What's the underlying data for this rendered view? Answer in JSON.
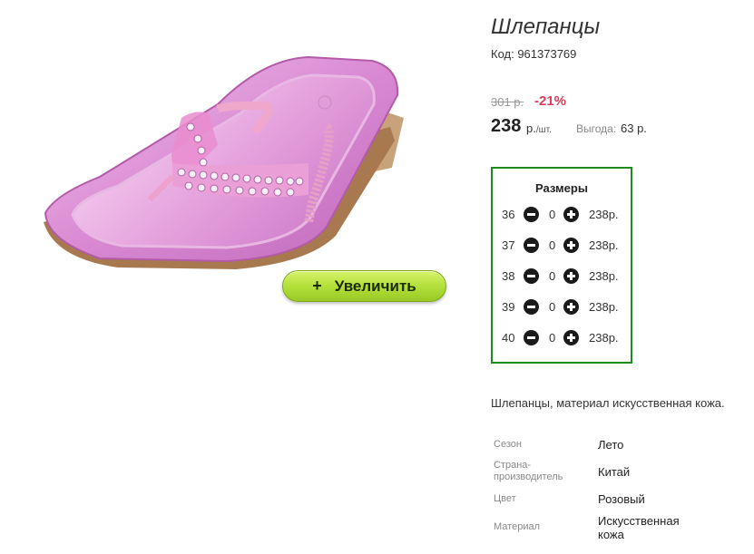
{
  "product": {
    "title": "Шлепанцы",
    "sku": "Код: 961373769",
    "old_price": "301 р.",
    "discount": "-21%",
    "price": "238",
    "price_unit": "р.",
    "price_unit_suffix": "/шт.",
    "benefit_label": "Выгода:",
    "benefit_value": "63 р."
  },
  "gallery": {
    "zoom_label": "Увеличить",
    "zoom_icon": "plus"
  },
  "sizes": {
    "title": "Размеры",
    "rows": [
      {
        "size": "36",
        "qty": "0",
        "price": "238р."
      },
      {
        "size": "37",
        "qty": "0",
        "price": "238р."
      },
      {
        "size": "38",
        "qty": "0",
        "price": "238р."
      },
      {
        "size": "39",
        "qty": "0",
        "price": "238р."
      },
      {
        "size": "40",
        "qty": "0",
        "price": "238р."
      }
    ]
  },
  "description": "Шлепанцы, материал искусственная кожа.",
  "attributes": [
    {
      "label": "Сезон",
      "value": "Лето"
    },
    {
      "label": "Страна-\nпроизводитель",
      "value": "Китай"
    },
    {
      "label": "Цвет",
      "value": "Розовый"
    },
    {
      "label": "Материал",
      "value": "Искусственная\nкожа"
    }
  ],
  "colors": {
    "accent_green": "#1f8a1f",
    "discount_red": "#e03a5c",
    "button_green": "#b4e03a"
  }
}
